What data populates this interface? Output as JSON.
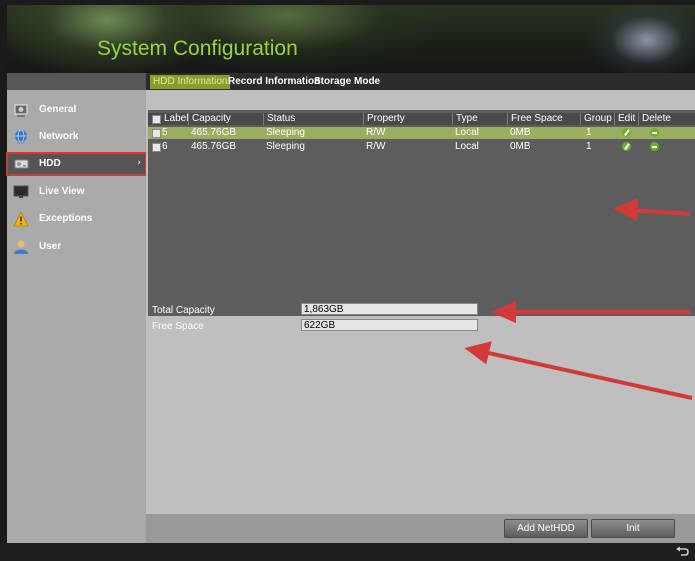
{
  "header": {
    "title": "System Configuration"
  },
  "tabs": [
    {
      "label": "HDD Information",
      "active": true
    },
    {
      "label": "Record Information",
      "active": false
    },
    {
      "label": "Storage Mode",
      "active": false
    }
  ],
  "sidebar": {
    "items": [
      {
        "label": "General",
        "icon": "general-icon",
        "selected": false
      },
      {
        "label": "Network",
        "icon": "network-icon",
        "selected": false
      },
      {
        "label": "HDD",
        "icon": "hdd-icon",
        "selected": true,
        "chevron": "›"
      },
      {
        "label": "Live View",
        "icon": "monitor-icon",
        "selected": false
      },
      {
        "label": "Exceptions",
        "icon": "warning-icon",
        "selected": false
      },
      {
        "label": "User",
        "icon": "user-icon",
        "selected": false
      }
    ]
  },
  "hdd_table": {
    "columns": [
      "Label",
      "Capacity",
      "Status",
      "Property",
      "Type",
      "Free Space",
      "Group",
      "Edit",
      "Delete"
    ],
    "rows": [
      {
        "label": "5",
        "capacity": "465.76GB",
        "status": "Sleeping",
        "property": "R/W",
        "type": "Local",
        "free_space": "0MB",
        "group": "1",
        "selected": true
      },
      {
        "label": "6",
        "capacity": "465.76GB",
        "status": "Sleeping",
        "property": "R/W",
        "type": "Local",
        "free_space": "0MB",
        "group": "1",
        "selected": false
      }
    ]
  },
  "summary": {
    "total_capacity_label": "Total Capacity",
    "total_capacity_value": "1,863GB",
    "free_space_label": "Free Space",
    "free_space_value": "622GB"
  },
  "footer": {
    "add_nethdd_label": "Add NetHDD",
    "init_label": "Init"
  },
  "colors": {
    "accent_green": "#9bd33a",
    "annotation_red": "#d23a3a",
    "selected_row": "#9aae62"
  }
}
